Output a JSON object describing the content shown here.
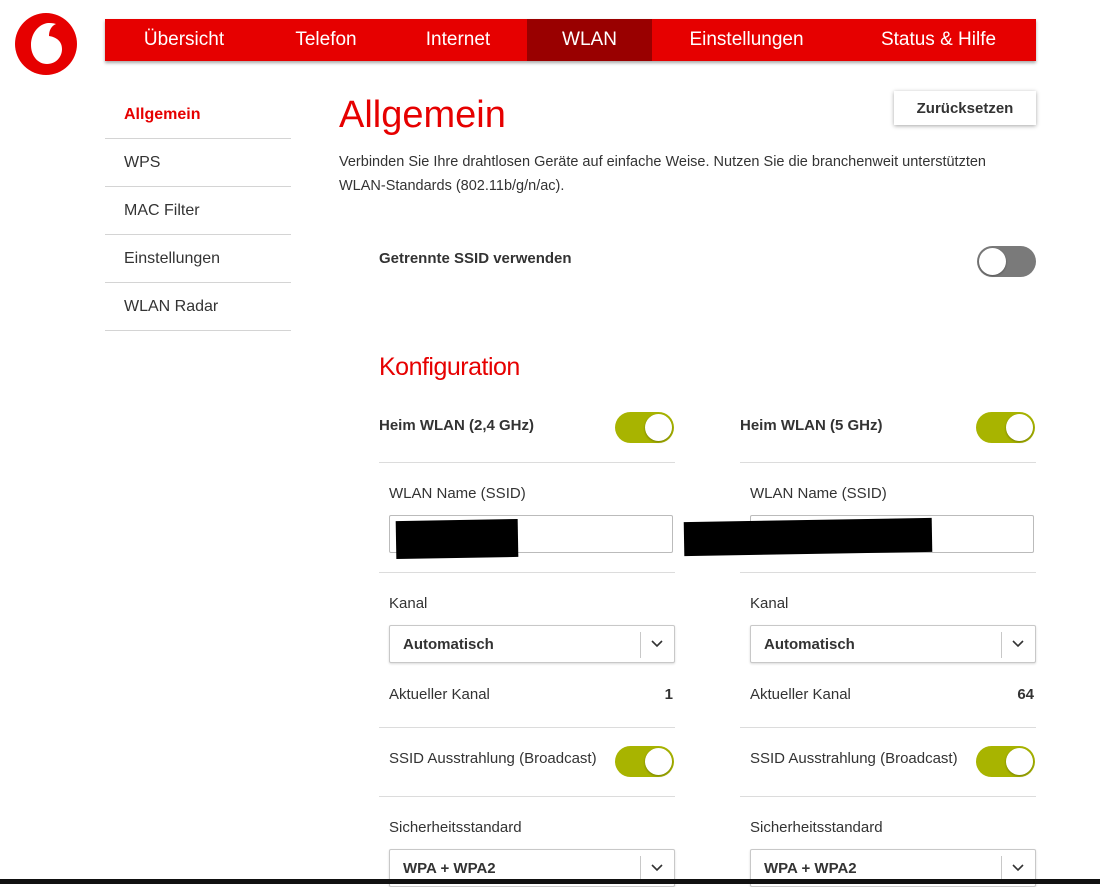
{
  "colors": {
    "brand_red": "#e60000",
    "active_tab": "#990000",
    "toggle_on": "#a8b400",
    "toggle_off": "#7a7a7a"
  },
  "logo": {
    "icon": "vodafone-logo-icon"
  },
  "nav": {
    "tabs": [
      {
        "label": "Übersicht"
      },
      {
        "label": "Telefon"
      },
      {
        "label": "Internet"
      },
      {
        "label": "WLAN",
        "active": true
      },
      {
        "label": "Einstellungen"
      },
      {
        "label": "Status & Hilfe"
      }
    ]
  },
  "sidebar": {
    "items": [
      {
        "label": "Allgemein",
        "active": true
      },
      {
        "label": "WPS"
      },
      {
        "label": "MAC Filter"
      },
      {
        "label": "Einstellungen"
      },
      {
        "label": "WLAN Radar"
      }
    ]
  },
  "page": {
    "title": "Allgemein",
    "reset_label": "Zurücksetzen",
    "description": "Verbinden Sie Ihre drahtlosen Geräte auf einfache Weise. Nutzen Sie die branchenweit unterstützten WLAN-Standards (802.11b/g/n/ac).",
    "separate_ssid": {
      "label": "Getrennte SSID verwenden",
      "enabled": false
    }
  },
  "config": {
    "title": "Konfiguration",
    "bands": [
      {
        "header": "Heim WLAN (2,4 GHz)",
        "enabled": true,
        "ssid_label": "WLAN Name (SSID)",
        "ssid_value": "",
        "channel_label": "Kanal",
        "channel_value": "Automatisch",
        "current_channel_label": "Aktueller Kanal",
        "current_channel": "1",
        "broadcast_label": "SSID Ausstrahlung (Broadcast)",
        "broadcast_enabled": true,
        "security_label": "Sicherheitsstandard",
        "security_value": "WPA + WPA2"
      },
      {
        "header": "Heim WLAN (5 GHz)",
        "enabled": true,
        "ssid_label": "WLAN Name (SSID)",
        "ssid_value": "",
        "channel_label": "Kanal",
        "channel_value": "Automatisch",
        "current_channel_label": "Aktueller Kanal",
        "current_channel": "64",
        "broadcast_label": "SSID Ausstrahlung (Broadcast)",
        "broadcast_enabled": true,
        "security_label": "Sicherheitsstandard",
        "security_value": "WPA + WPA2"
      }
    ]
  }
}
